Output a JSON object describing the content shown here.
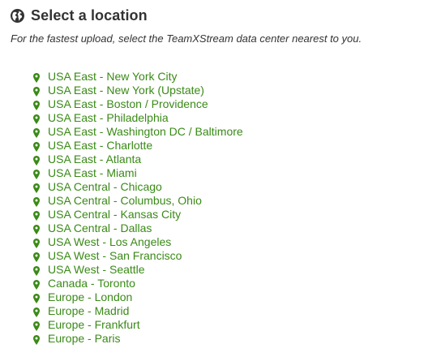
{
  "header": {
    "title": "Select a location",
    "icon": "globe-icon"
  },
  "subtitle": "For the fastest upload, select the TeamXStream data center nearest to you.",
  "colors": {
    "link": "#3a8a17",
    "text": "#333333"
  },
  "locations": [
    {
      "label": "USA East - New York City"
    },
    {
      "label": "USA East - New York (Upstate)"
    },
    {
      "label": "USA East - Boston / Providence"
    },
    {
      "label": "USA East - Philadelphia"
    },
    {
      "label": "USA East - Washington DC / Baltimore"
    },
    {
      "label": "USA East - Charlotte"
    },
    {
      "label": "USA East - Atlanta"
    },
    {
      "label": "USA East - Miami"
    },
    {
      "label": "USA Central - Chicago"
    },
    {
      "label": "USA Central - Columbus, Ohio"
    },
    {
      "label": "USA Central - Kansas City"
    },
    {
      "label": "USA Central - Dallas"
    },
    {
      "label": "USA West - Los Angeles"
    },
    {
      "label": "USA West - San Francisco"
    },
    {
      "label": "USA West - Seattle"
    },
    {
      "label": "Canada - Toronto"
    },
    {
      "label": "Europe - London"
    },
    {
      "label": "Europe - Madrid"
    },
    {
      "label": "Europe - Frankfurt"
    },
    {
      "label": "Europe - Paris"
    }
  ]
}
